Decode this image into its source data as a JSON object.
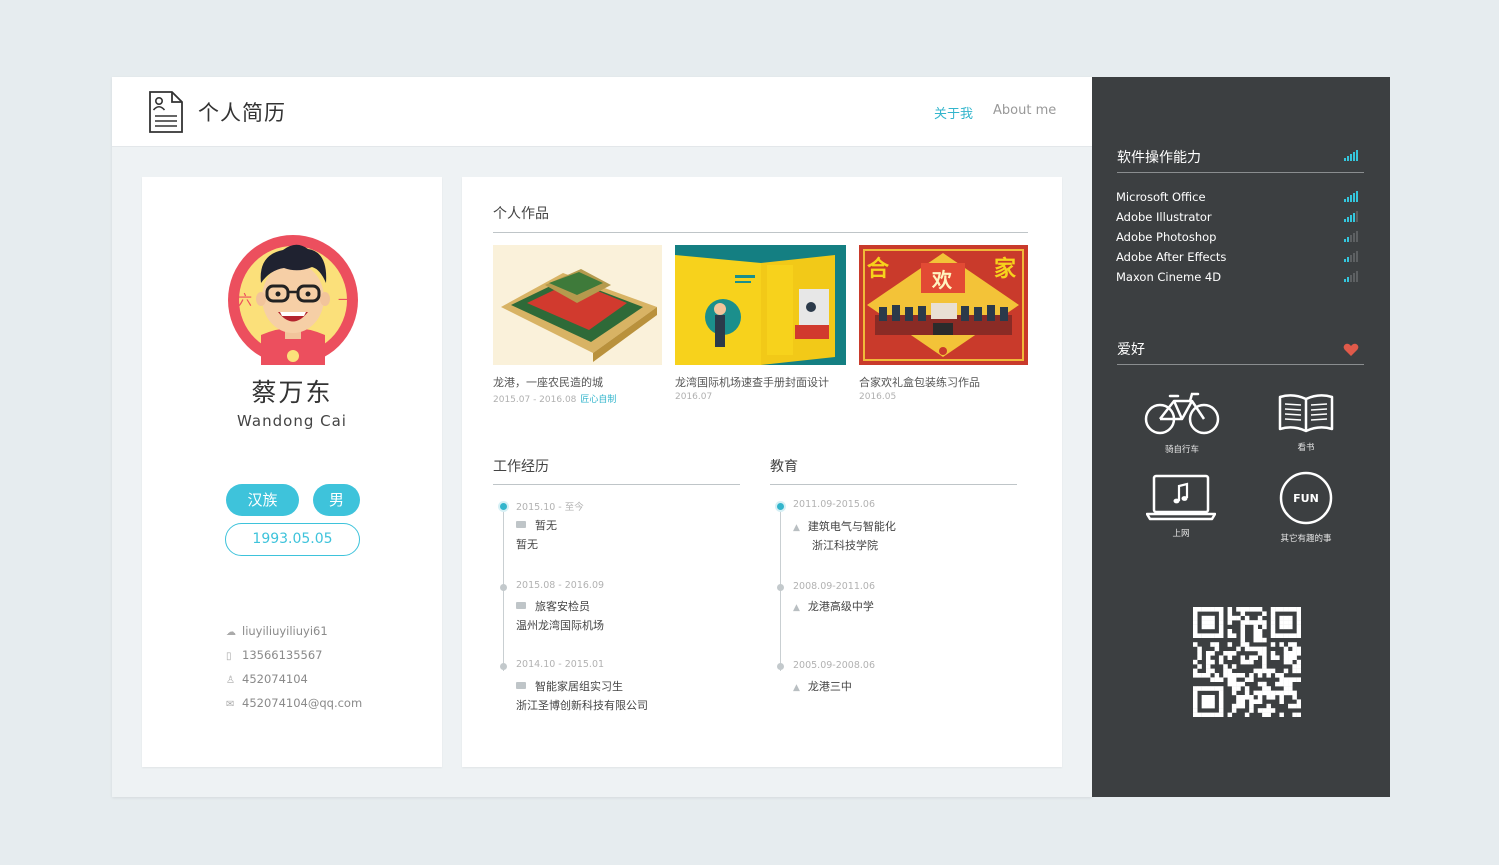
{
  "header": {
    "title": "个人简历",
    "nav_about_cn": "关于我",
    "nav_about_en": "About me"
  },
  "profile": {
    "name_cn": "蔡万东",
    "name_en": "Wandong  Cai",
    "avatar_left_char": "六",
    "avatar_right_char": "一",
    "tags": [
      "汉族",
      "男"
    ],
    "birth": "1993.05.05",
    "contacts": [
      {
        "icon": "wechat-icon",
        "value": "liuyiliuyiliuyi61"
      },
      {
        "icon": "phone-icon",
        "value": "13566135567"
      },
      {
        "icon": "qq-icon",
        "value": "452074104"
      },
      {
        "icon": "mail-icon",
        "value": "452074104@qq.com"
      }
    ]
  },
  "works": {
    "title": "个人作品",
    "items": [
      {
        "caption": "龙港，一座农民造的城",
        "date": "2015.07 - 2016.08",
        "link": "匠心自制"
      },
      {
        "caption": "龙湾国际机场速查手册封面设计",
        "date": "2016.07",
        "link": ""
      },
      {
        "caption": "合家欢礼盒包装练习作品",
        "date": "2016.05",
        "link": ""
      }
    ],
    "art3_chars": [
      "合",
      "欢",
      "家"
    ]
  },
  "experience": {
    "title": "工作经历",
    "items": [
      {
        "date": "2015.10 - 至今",
        "role": "暂无",
        "org": "暂无"
      },
      {
        "date": "2015.08 - 2016.09",
        "role": "旅客安检员",
        "org": "温州龙湾国际机场"
      },
      {
        "date": "2014.10 - 2015.01",
        "role": "智能家居组实习生",
        "org": "浙江圣博创新科技有限公司"
      }
    ]
  },
  "education": {
    "title": "教育",
    "items": [
      {
        "date": "2011.09-2015.06",
        "school": "建筑电气与智能化",
        "org": "浙江科技学院"
      },
      {
        "date": "2008.09-2011.06",
        "school": "龙港高级中学",
        "org": ""
      },
      {
        "date": "2005.09-2008.06",
        "school": "龙港三中",
        "org": ""
      }
    ]
  },
  "sidebar": {
    "skills_title": "软件操作能力",
    "skills": [
      {
        "name": "Microsoft Office",
        "level": 5
      },
      {
        "name": "Adobe  Illustrator",
        "level": 4
      },
      {
        "name": "Adobe  Photoshop",
        "level": 2
      },
      {
        "name": "Adobe  After Effects",
        "level": 2
      },
      {
        "name": "Maxon Cineme 4D",
        "level": 2
      }
    ],
    "hobbies_title": "爱好",
    "hobbies": [
      {
        "icon": "bicycle-icon",
        "label": "骑自行车"
      },
      {
        "icon": "book-icon",
        "label": "看书"
      },
      {
        "icon": "laptop-music-icon",
        "label": "上网"
      },
      {
        "icon": "fun-icon",
        "label": "其它有趣的事",
        "badge": "FUN"
      }
    ]
  },
  "colors": {
    "accent": "#3ec3db",
    "sidebar_bg": "#3c3f41",
    "heart": "#e05a4a",
    "avatar_ring": "#ec4f5e"
  }
}
